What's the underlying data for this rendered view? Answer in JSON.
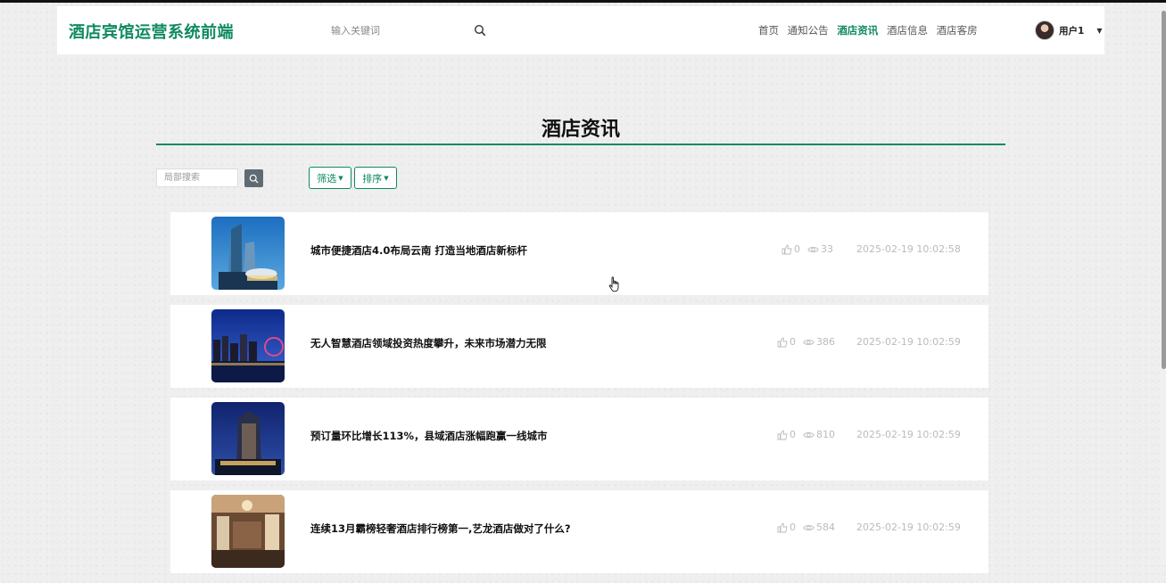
{
  "header": {
    "brand": "酒店宾馆运营系统前端",
    "search_placeholder": "输入关键词",
    "nav": [
      "首页",
      "通知公告",
      "酒店资讯",
      "酒店信息",
      "酒店客房"
    ],
    "active_nav": "酒店资讯",
    "user_name": "用户1"
  },
  "page": {
    "title": "酒店资讯",
    "local_search_placeholder": "局部搜索",
    "filter_label": "筛选",
    "sort_label": "排序"
  },
  "colors": {
    "accent": "#0f8a5f",
    "meta": "#bbbbbb"
  },
  "articles": [
    {
      "title": "城市便捷酒店4.0布局云南 打造当地酒店新标杆",
      "likes": "0",
      "views": "33",
      "date": "2025-02-19 10:02:58"
    },
    {
      "title": "无人智慧酒店领域投资热度攀升，未来市场潜力无限",
      "likes": "0",
      "views": "386",
      "date": "2025-02-19 10:02:59"
    },
    {
      "title": "预订量环比增长113%，县域酒店涨幅跑赢一线城市",
      "likes": "0",
      "views": "810",
      "date": "2025-02-19 10:02:59"
    },
    {
      "title": "连续13月霸榜轻奢酒店排行榜第一,艺龙酒店做对了什么?",
      "likes": "0",
      "views": "584",
      "date": "2025-02-19 10:02:59"
    }
  ]
}
